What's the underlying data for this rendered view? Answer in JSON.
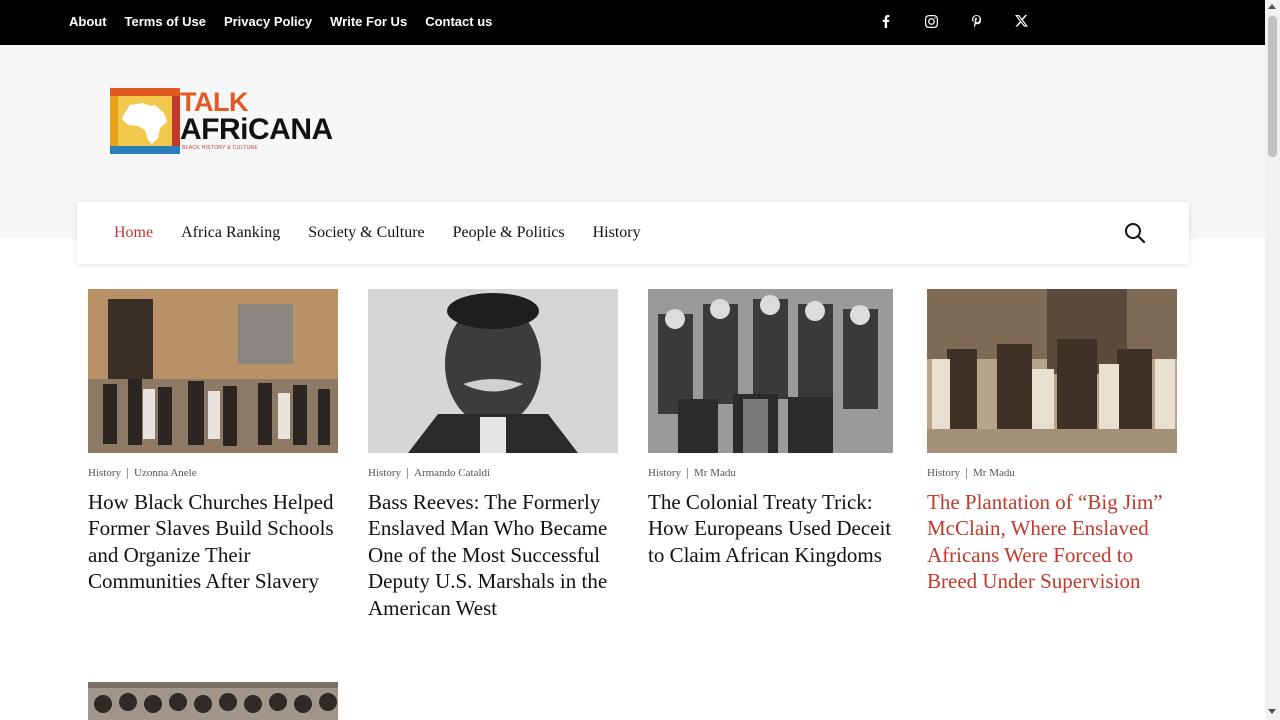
{
  "top_links": [
    "About",
    "Terms of Use",
    "Privacy Policy",
    "Write For Us",
    "Contact us"
  ],
  "socials": [
    "facebook-icon",
    "instagram-icon",
    "pinterest-icon",
    "x-icon"
  ],
  "logo": {
    "line1": "TALK",
    "line2": "AFRiCANA",
    "tagline": "BLACK HISTORY & CULTURE"
  },
  "nav": {
    "items": [
      "Home",
      "Africa Ranking",
      "Society & Culture",
      "People & Politics",
      "History"
    ],
    "active_index": 0
  },
  "colors": {
    "accent": "#c0392b",
    "topbar": "#000000",
    "header_bg": "#f7f7f7"
  },
  "articles": [
    {
      "category": "History",
      "author": "Uzonna Anele",
      "title": "How Black Churches Helped Former Slaves Build Schools and Organize Their Communities After Slavery"
    },
    {
      "category": "History",
      "author": "Armando Cataldi",
      "title": "Bass Reeves: The Formerly Enslaved Man Who Became One of the Most Successful Deputy U.S. Marshals in the American West"
    },
    {
      "category": "History",
      "author": "Mr Madu",
      "title": "The Colonial Treaty Trick: How Europeans Used Deceit to Claim African Kingdoms"
    },
    {
      "category": "History",
      "author": "Mr Madu",
      "title": "The Plantation of “Big Jim” McClain, Where Enslaved Africans Were Forced to Breed Under Supervision"
    }
  ]
}
